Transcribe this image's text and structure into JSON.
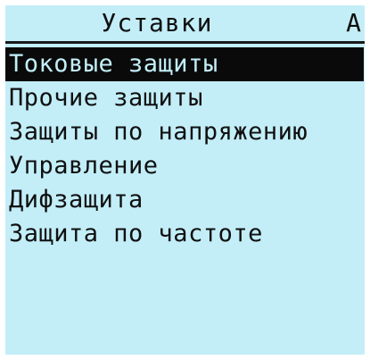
{
  "header": {
    "title": "Уставки",
    "indicator": "A"
  },
  "menu": {
    "selected_index": 0,
    "items": [
      {
        "label": "Токовые защиты"
      },
      {
        "label": "Прочие защиты"
      },
      {
        "label": "Защиты по напряжению"
      },
      {
        "label": "Управление"
      },
      {
        "label": "Дифзащита"
      },
      {
        "label": "Защита по частоте"
      }
    ]
  },
  "colors": {
    "lcd_background": "#c3eef8",
    "text": "#101010",
    "selection_background": "#0a0a0a"
  }
}
